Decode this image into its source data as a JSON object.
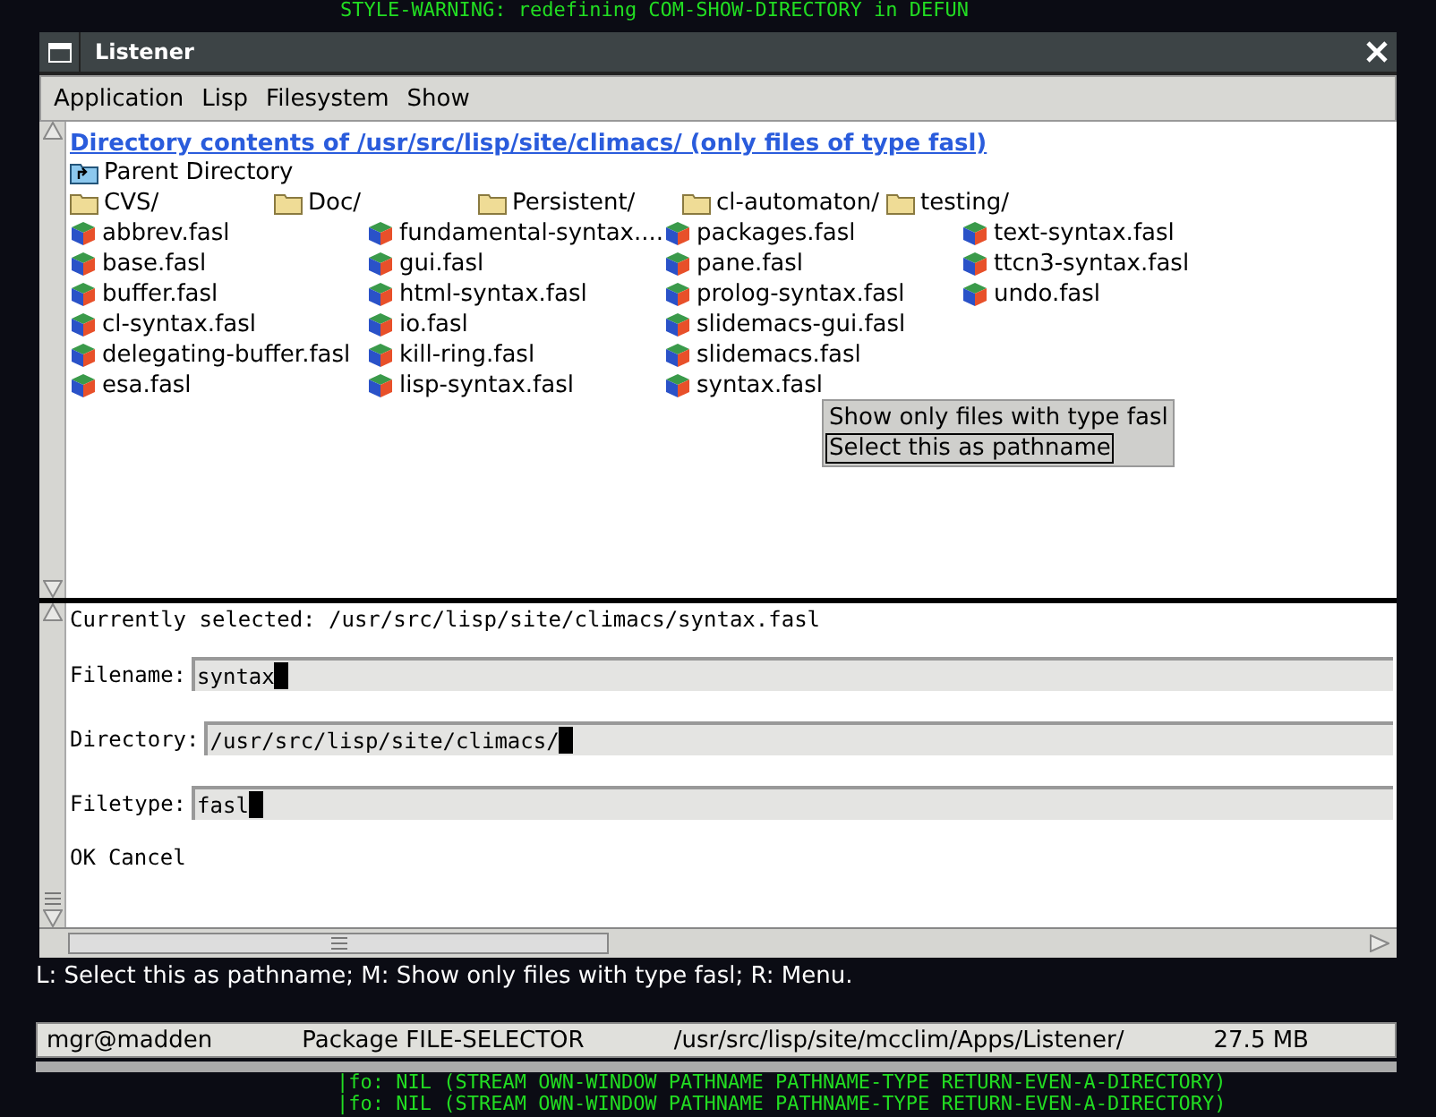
{
  "terminal_top": [
    "STYLE-WARNING: redefining COM-SHOW-DIRECTORY in DEFUN"
  ],
  "window": {
    "title": "Listener"
  },
  "menu": [
    "Application",
    "Lisp",
    "Filesystem",
    "Show"
  ],
  "directory": {
    "heading": "Directory contents of /usr/src/lisp/site/climacs/ (only files of type fasl)",
    "parent": {
      "kind": "parent",
      "label": "Parent Directory"
    },
    "folders": [
      {
        "kind": "folder",
        "label": "CVS/"
      },
      {
        "kind": "folder",
        "label": "Doc/"
      },
      {
        "kind": "folder",
        "label": "Persistent/"
      },
      {
        "kind": "folder",
        "label": "cl-automaton/"
      },
      {
        "kind": "folder",
        "label": "testing/"
      }
    ],
    "files": [
      {
        "kind": "file",
        "label": "abbrev.fasl"
      },
      {
        "kind": "file",
        "label": "fundamental-syntax...."
      },
      {
        "kind": "file",
        "label": "packages.fasl"
      },
      {
        "kind": "file",
        "label": "text-syntax.fasl"
      },
      {
        "kind": "file",
        "label": "base.fasl"
      },
      {
        "kind": "file",
        "label": "gui.fasl"
      },
      {
        "kind": "file",
        "label": "pane.fasl"
      },
      {
        "kind": "file",
        "label": "ttcn3-syntax.fasl"
      },
      {
        "kind": "file",
        "label": "buffer.fasl"
      },
      {
        "kind": "file",
        "label": "html-syntax.fasl"
      },
      {
        "kind": "file",
        "label": "prolog-syntax.fasl"
      },
      {
        "kind": "file",
        "label": "undo.fasl"
      },
      {
        "kind": "file",
        "label": "cl-syntax.fasl"
      },
      {
        "kind": "file",
        "label": "io.fasl"
      },
      {
        "kind": "file",
        "label": "slidemacs-gui.fasl"
      },
      {
        "kind": "empty"
      },
      {
        "kind": "file",
        "label": "delegating-buffer.fasl"
      },
      {
        "kind": "file",
        "label": "kill-ring.fasl"
      },
      {
        "kind": "file",
        "label": "slidemacs.fasl"
      },
      {
        "kind": "empty"
      },
      {
        "kind": "file",
        "label": "esa.fasl"
      },
      {
        "kind": "file",
        "label": "lisp-syntax.fasl"
      },
      {
        "kind": "file",
        "label": "syntax.fasl"
      }
    ]
  },
  "popup_menu": [
    {
      "label": "Show only files with type fasl",
      "selected": false
    },
    {
      "label": "Select this as pathname",
      "selected": true
    }
  ],
  "selection": {
    "current": "Currently selected: /usr/src/lisp/site/climacs/syntax.fasl",
    "fields": [
      {
        "label": "Filename:",
        "value": "syntax"
      },
      {
        "label": "Directory:",
        "value": "/usr/src/lisp/site/climacs/"
      },
      {
        "label": "Filetype:",
        "value": "fasl"
      }
    ],
    "buttons": [
      "OK",
      "Cancel"
    ]
  },
  "pointer_doc": "L: Select this as pathname; M: Show only files with type fasl; R: Menu.",
  "status_bar": [
    "mgr@madden",
    "Package FILE-SELECTOR",
    "/usr/src/lisp/site/mcclim/Apps/Listener/",
    "27.5 MB"
  ],
  "terminal_bottom": [
    "|fo: NIL (STREAM OWN-WINDOW PATHNAME PATHNAME-TYPE RETURN-EVEN-A-DIRECTORY)",
    "|fo: NIL (STREAM OWN-WINDOW PATHNAME PATHNAME-TYPE RETURN-EVEN-A-DIRECTORY)"
  ]
}
